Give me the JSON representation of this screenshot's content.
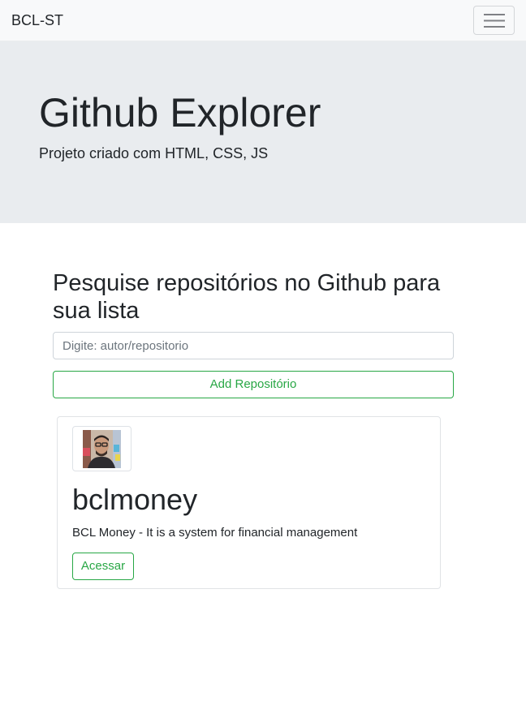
{
  "navbar": {
    "brand": "BCL-ST",
    "toggler_icon": "hamburger-menu-icon"
  },
  "hero": {
    "title": "Github Explorer",
    "subtitle": "Projeto criado com HTML, CSS, JS"
  },
  "search": {
    "heading": "Pesquise repositórios no Github para sua lista",
    "placeholder": "Digite: autor/repositorio",
    "value": "",
    "add_button_label": "Add Repositório"
  },
  "repositories": [
    {
      "name": "bclmoney",
      "description": "BCL Money - It is a system for financial management",
      "button_label": "Acessar",
      "avatar_icon": "user-avatar-photo"
    }
  ],
  "colors": {
    "navbar_bg": "#f8f9fa",
    "jumbotron_bg": "#e9ecef",
    "success": "#28a745",
    "text": "#212529"
  }
}
